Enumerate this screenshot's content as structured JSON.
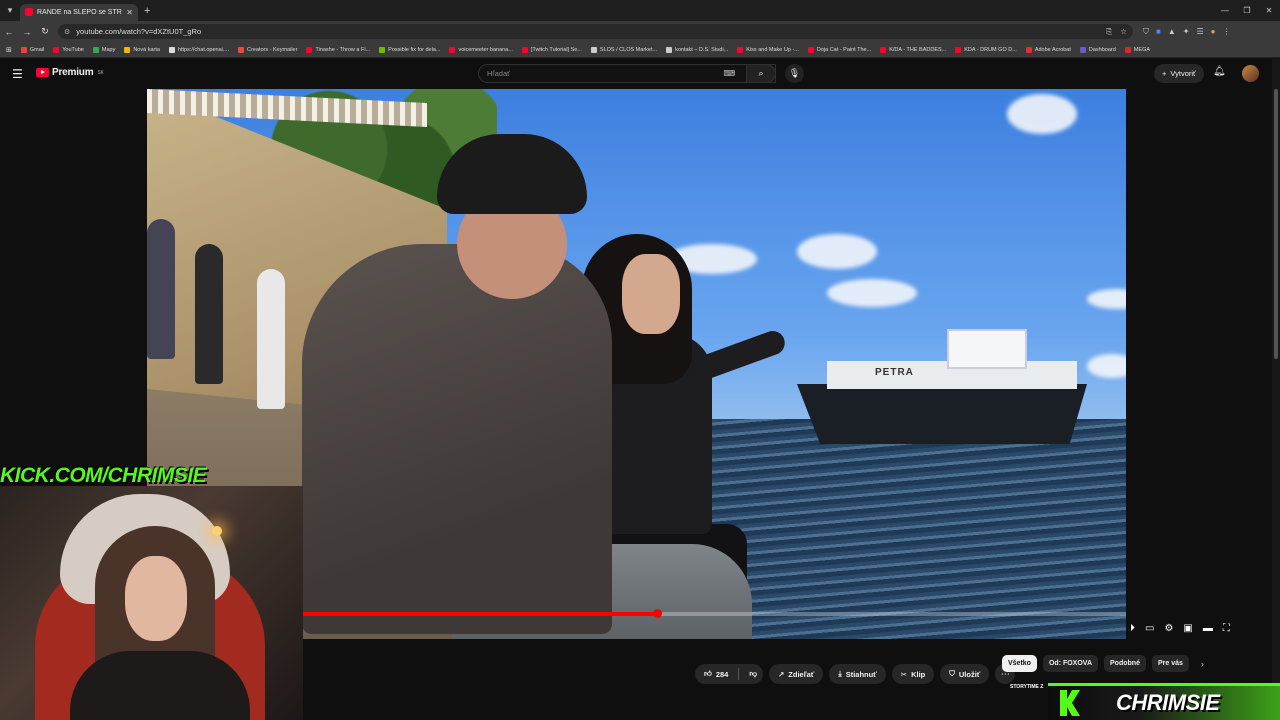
{
  "browser": {
    "tab_title": "RANDE na SLEPO se STREAMER...",
    "url": "youtube.com/watch?v=dXZtU0T_gRo",
    "bookmarks": [
      {
        "label": "Gmail",
        "color": "#ea4335"
      },
      {
        "label": "YouTube",
        "color": "#ff0033"
      },
      {
        "label": "Mapy",
        "color": "#34a853"
      },
      {
        "label": "Nová karta",
        "color": "#f4b400"
      },
      {
        "label": "https://chat.openai....",
        "color": "#dddddd"
      },
      {
        "label": "Creators - Keymailer",
        "color": "#e84c3d"
      },
      {
        "label": "Tinashe - Throw a Fi...",
        "color": "#ff0033"
      },
      {
        "label": "Possible fix for dela...",
        "color": "#76b900"
      },
      {
        "label": "voicemeeter banana...",
        "color": "#ff0033"
      },
      {
        "label": "[Twitch Tutorial] Se...",
        "color": "#ff0033"
      },
      {
        "label": "SLOS / CLOS Market...",
        "color": "#cccccc"
      },
      {
        "label": "kontakt – D.S. Studi...",
        "color": "#cccccc"
      },
      {
        "label": "Kiss and Make Up -...",
        "color": "#ff0033"
      },
      {
        "label": "Doja Cat - Paint The...",
        "color": "#ff0033"
      },
      {
        "label": "K/DA - THE BADDES...",
        "color": "#ff0033"
      },
      {
        "label": "KDA - DRUM GO D...",
        "color": "#ff0033"
      },
      {
        "label": "Adobe Acrobat",
        "color": "#e02f2f"
      },
      {
        "label": "Dashboard",
        "color": "#6a5acd"
      },
      {
        "label": "MEGA",
        "color": "#d9272e"
      }
    ]
  },
  "youtube": {
    "logo_text": "Premium",
    "region": "SK",
    "search_placeholder": "Hľadať",
    "create_label": "Vytvoriť"
  },
  "player": {
    "progress_fraction": 0.43,
    "boat_name": "PETRA"
  },
  "actions": {
    "like_count": "284",
    "share_label": "Zdieľať",
    "download_label": "Stiahnuť",
    "clip_label": "Klip",
    "save_label": "Uložiť"
  },
  "chips": [
    {
      "label": "Všetko",
      "active": true
    },
    {
      "label": "Od: FOXOVA",
      "active": false
    },
    {
      "label": "Podobné",
      "active": false
    },
    {
      "label": "Pre vás",
      "active": false
    }
  ],
  "overlay": {
    "kick_url": "KICK.COM/CHRIMSIE",
    "streamer_name": "CHRIMSIE",
    "ticker_text": "STORYTIME Z",
    "accent_color": "#53fc18"
  }
}
